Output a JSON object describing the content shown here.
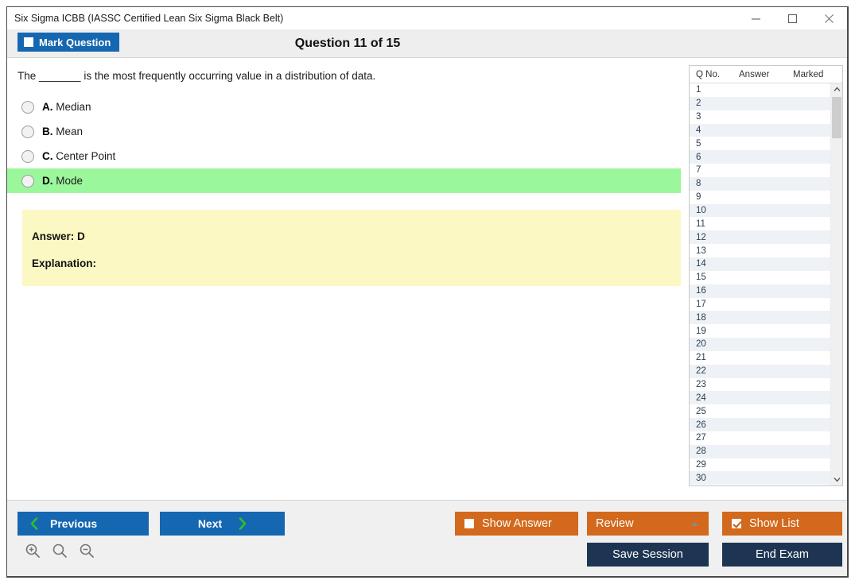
{
  "window": {
    "title": "Six Sigma ICBB (IASSC Certified Lean Six Sigma Black Belt)",
    "controls": {
      "minimize": "minimize-icon",
      "maximize": "maximize-icon",
      "close": "close-icon"
    }
  },
  "header": {
    "mark_question_label": "Mark Question",
    "mark_question_checked": false,
    "question_counter": "Question 11 of 15"
  },
  "question": {
    "text": "The _______ is the most frequently occurring value in a distribution of data.",
    "options": [
      {
        "letter": "A.",
        "text": "Median",
        "correct": false
      },
      {
        "letter": "B.",
        "text": "Mean",
        "correct": false
      },
      {
        "letter": "C.",
        "text": "Center Point",
        "correct": false
      },
      {
        "letter": "D.",
        "text": "Mode",
        "correct": true
      }
    ],
    "selected": null
  },
  "answer_panel": {
    "answer_line": "Answer: D",
    "explanation_line": "Explanation:",
    "explanation_body": ""
  },
  "question_list": {
    "columns": [
      "Q No.",
      "Answer",
      "Marked"
    ],
    "rows": [
      {
        "no": "1",
        "answer": "",
        "marked": ""
      },
      {
        "no": "2",
        "answer": "",
        "marked": ""
      },
      {
        "no": "3",
        "answer": "",
        "marked": ""
      },
      {
        "no": "4",
        "answer": "",
        "marked": ""
      },
      {
        "no": "5",
        "answer": "",
        "marked": ""
      },
      {
        "no": "6",
        "answer": "",
        "marked": ""
      },
      {
        "no": "7",
        "answer": "",
        "marked": ""
      },
      {
        "no": "8",
        "answer": "",
        "marked": ""
      },
      {
        "no": "9",
        "answer": "",
        "marked": ""
      },
      {
        "no": "10",
        "answer": "",
        "marked": ""
      },
      {
        "no": "11",
        "answer": "",
        "marked": ""
      },
      {
        "no": "12",
        "answer": "",
        "marked": ""
      },
      {
        "no": "13",
        "answer": "",
        "marked": ""
      },
      {
        "no": "14",
        "answer": "",
        "marked": ""
      },
      {
        "no": "15",
        "answer": "",
        "marked": ""
      },
      {
        "no": "16",
        "answer": "",
        "marked": ""
      },
      {
        "no": "17",
        "answer": "",
        "marked": ""
      },
      {
        "no": "18",
        "answer": "",
        "marked": ""
      },
      {
        "no": "19",
        "answer": "",
        "marked": ""
      },
      {
        "no": "20",
        "answer": "",
        "marked": ""
      },
      {
        "no": "21",
        "answer": "",
        "marked": ""
      },
      {
        "no": "22",
        "answer": "",
        "marked": ""
      },
      {
        "no": "23",
        "answer": "",
        "marked": ""
      },
      {
        "no": "24",
        "answer": "",
        "marked": ""
      },
      {
        "no": "25",
        "answer": "",
        "marked": ""
      },
      {
        "no": "26",
        "answer": "",
        "marked": ""
      },
      {
        "no": "27",
        "answer": "",
        "marked": ""
      },
      {
        "no": "28",
        "answer": "",
        "marked": ""
      },
      {
        "no": "29",
        "answer": "",
        "marked": ""
      },
      {
        "no": "30",
        "answer": "",
        "marked": ""
      }
    ]
  },
  "toolbar": {
    "previous_label": "Previous",
    "next_label": "Next",
    "show_answer_label": "Show Answer",
    "show_answer_checked": false,
    "review_label": "Review",
    "show_list_label": "Show List",
    "show_list_checked": true,
    "save_session_label": "Save Session",
    "end_exam_label": "End Exam"
  },
  "zoom_controls": [
    {
      "name": "zoom-in-icon"
    },
    {
      "name": "zoom-reset-icon"
    },
    {
      "name": "zoom-out-icon"
    }
  ],
  "colors": {
    "accent_blue": "#1667b1",
    "accent_orange": "#d2691c",
    "navy": "#1d3552",
    "correct_green": "#9bf79b",
    "answer_yellow": "#fcf8c4",
    "arrow_green": "#2fbf2f"
  }
}
